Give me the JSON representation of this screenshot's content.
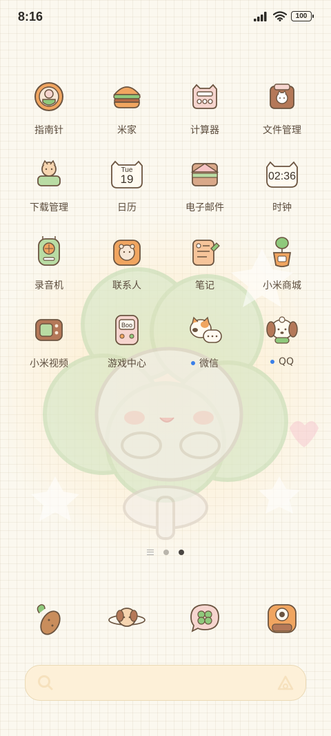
{
  "status_bar": {
    "time": "8:16",
    "battery": "100",
    "icons": [
      "signal-icon",
      "wifi-icon",
      "battery-icon"
    ]
  },
  "apps": [
    {
      "label": "指南针",
      "icon": "compass-icon",
      "badge": false
    },
    {
      "label": "米家",
      "icon": "burger-icon",
      "badge": false
    },
    {
      "label": "计算器",
      "icon": "calculator-icon",
      "badge": false
    },
    {
      "label": "文件管理",
      "icon": "folder-cat-icon",
      "badge": false
    },
    {
      "label": "下载管理",
      "icon": "download-cat-icon",
      "badge": false
    },
    {
      "label": "日历",
      "icon": "calendar-icon",
      "badge": false,
      "day": "Tue",
      "date": "19"
    },
    {
      "label": "电子邮件",
      "icon": "envelope-icon",
      "badge": false
    },
    {
      "label": "时钟",
      "icon": "clock-icon",
      "badge": false,
      "time": "02:36"
    },
    {
      "label": "录音机",
      "icon": "recorder-icon",
      "badge": false
    },
    {
      "label": "联系人",
      "icon": "contact-bear-icon",
      "badge": false
    },
    {
      "label": "笔记",
      "icon": "notepad-icon",
      "badge": false
    },
    {
      "label": "小米商城",
      "icon": "plant-pot-icon",
      "badge": false
    },
    {
      "label": "小米视频",
      "icon": "tv-icon",
      "badge": false
    },
    {
      "label": "游戏中心",
      "icon": "game-console-icon",
      "badge": false,
      "screen": "Boo"
    },
    {
      "label": "微信",
      "icon": "cat-chat-icon",
      "badge": true
    },
    {
      "label": "QQ",
      "icon": "puppy-icon",
      "badge": true
    }
  ],
  "dock": [
    {
      "icon": "phone-peanut-icon"
    },
    {
      "icon": "dog-planet-icon"
    },
    {
      "icon": "clover-bubble-icon"
    },
    {
      "icon": "camera-icon"
    }
  ],
  "page_indicator": {
    "pages": 2,
    "active": 2
  },
  "search": {
    "placeholder": ""
  },
  "colors": {
    "background": "#fbf8ef",
    "accent_orange": "#f0a560",
    "accent_green": "#8fc97c",
    "outline": "#6b5440",
    "badge_blue": "#3a7fe8"
  }
}
